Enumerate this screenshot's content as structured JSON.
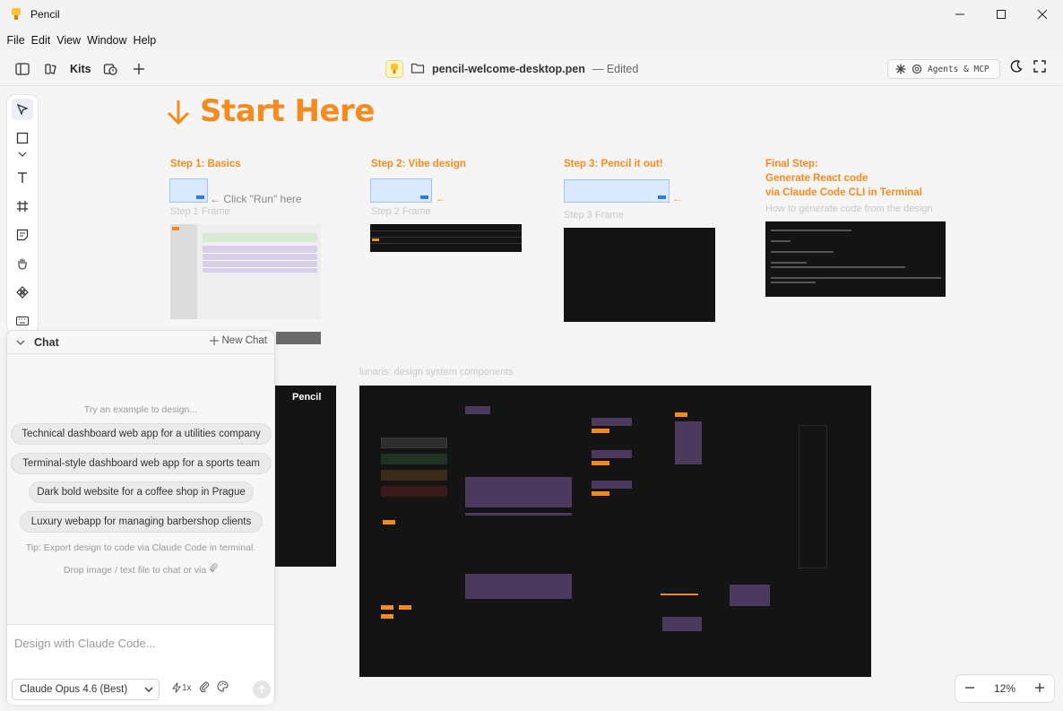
{
  "window": {
    "title": "Pencil"
  },
  "menu": [
    "File",
    "Edit",
    "View",
    "Window",
    "Help"
  ],
  "toolbar": {
    "kits_label": "Kits",
    "file_name": "pencil-welcome-desktop.pen",
    "file_status": "— Edited",
    "agents_label": "Agents & MCP"
  },
  "canvas": {
    "heading": "Start Here",
    "step1_title": "Step 1: Basics",
    "step1_frame_label": "Step 1 Frame",
    "click_run": "← Click \"Run\" here",
    "step2_title": "Step 2: Vibe design",
    "step2_frame_label": "Step 2 Frame",
    "step3_title": "Step 3: Pencil it out!",
    "step3_frame_label": "Step 3 Frame",
    "final_line1": "Final Step:",
    "final_line2": "Generate React code",
    "final_line3": "via Claude Code CLI in Terminal",
    "final_subtitle": "How to generate code from the design",
    "lunaris_label": "lunaris: design system components",
    "pencil_brand": "Pencil"
  },
  "chat": {
    "title": "Chat",
    "new_chat": "New Chat",
    "try_text": "Try an example to design...",
    "examples": [
      "Technical dashboard web app for a utilities company",
      "Terminal-style dashboard web app for a sports team",
      "Dark bold website for a coffee shop in Prague",
      "Luxury webapp for managing barbershop clients"
    ],
    "tip": "Tip: Export design to code via Claude Code in terminal.",
    "drop": "Drop image / text file to chat or via",
    "input_placeholder": "Design with Claude Code...",
    "model": "Claude Opus 4.6 (Best)",
    "speed": "1x"
  },
  "zoom": {
    "level": "12%"
  },
  "colors": {
    "accent": "#f58a1f",
    "note_blue": "#d9eaff",
    "dark_frame": "#141414"
  }
}
